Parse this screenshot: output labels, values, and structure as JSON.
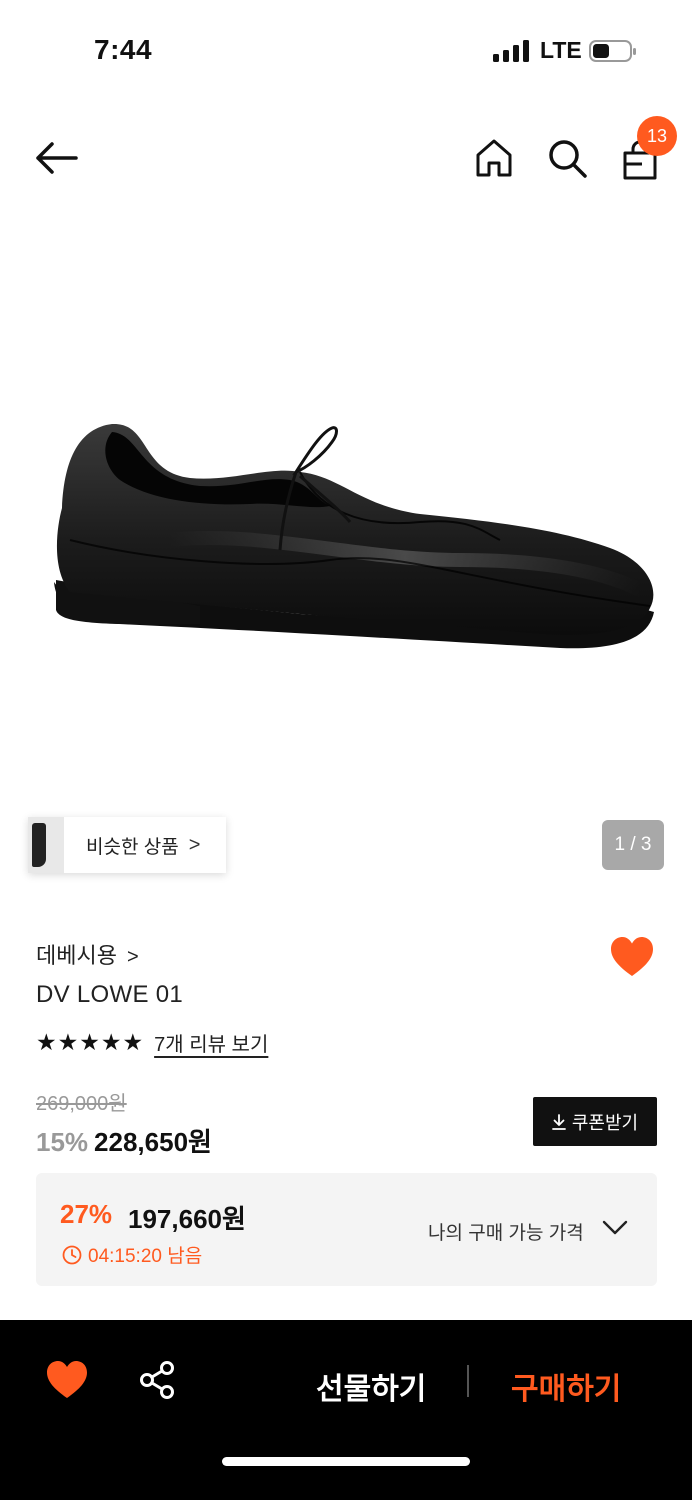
{
  "status": {
    "time": "7:44",
    "network": "LTE"
  },
  "nav": {
    "cart_count": "13"
  },
  "gallery": {
    "similar_label": "비슷한 상품",
    "chevron": ">",
    "pager": "1 / 3"
  },
  "product": {
    "brand": "데베시용",
    "brand_chevron": ">",
    "name": "DV LOWE 01",
    "stars": "★★★★★",
    "review_link": "7개 리뷰 보기",
    "rating_value": 5,
    "original_price": "269,000원",
    "discount_pct": "15%",
    "sale_price": "228,650원",
    "coupon_label": "쿠폰받기"
  },
  "my_price": {
    "discount_pct": "27%",
    "price": "197,660원",
    "timer": "04:15:20 남음",
    "label": "나의 구매 가능 가격"
  },
  "bottom_bar": {
    "gift_label": "선물하기",
    "buy_label": "구매하기"
  },
  "colors": {
    "accent": "#ff5a1f",
    "dark": "#000000",
    "box_bg": "#f4f4f4"
  }
}
